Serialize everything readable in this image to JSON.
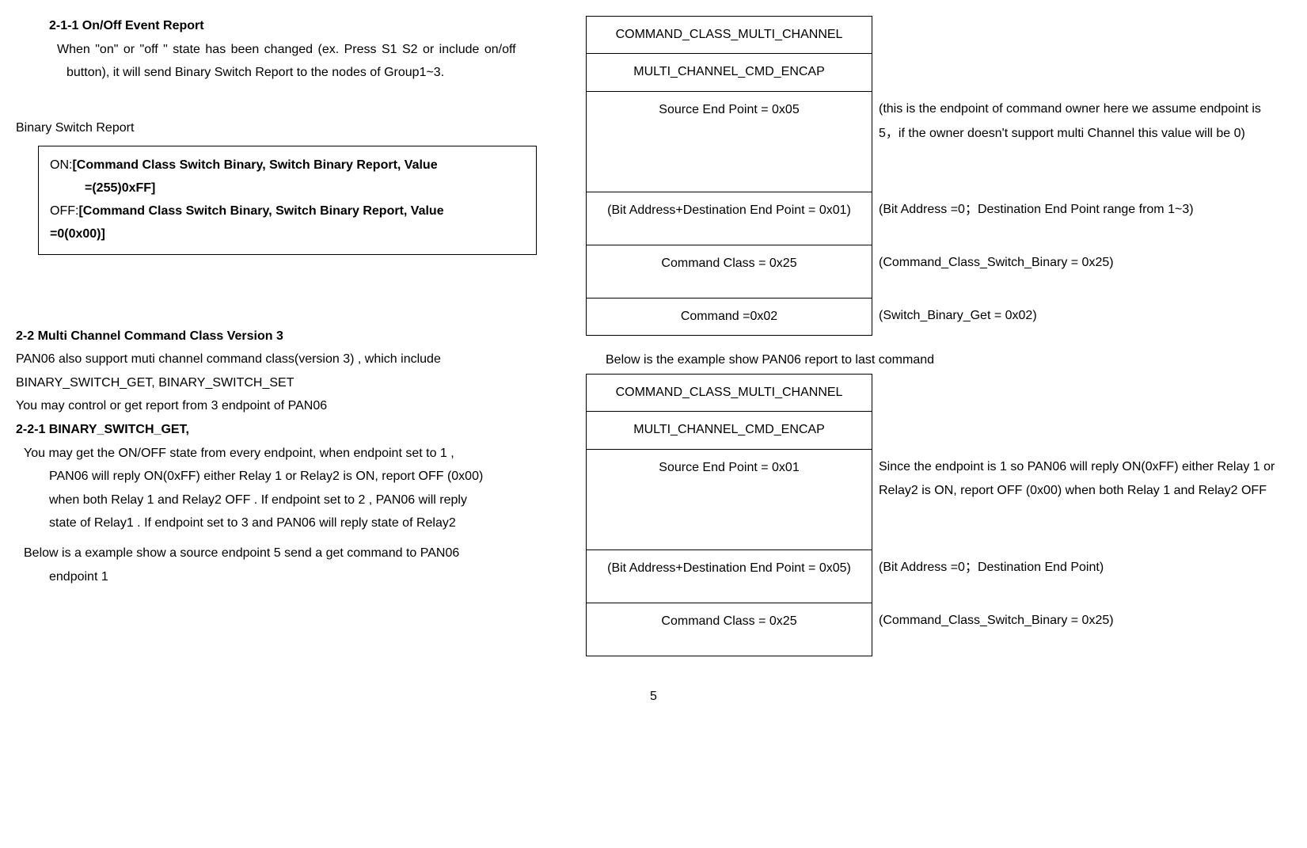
{
  "left": {
    "h211": "2-1-1 On/Off Event Report",
    "p211a": "When \"on\" or \"off \" state has been changed (ex. Press S1 S2 or include on/off",
    "p211b": "button), it will send Binary Switch Report to the nodes of Group1~3.",
    "bsr_title": "Binary Switch Report",
    "box_on_prefix": "ON:",
    "box_on_body1": "[Command Class Switch Binary, Switch Binary Report, Value",
    "box_on_body2": "=(255)0xFF]",
    "box_off_prefix": "OFF:",
    "box_off_body1": "[Command Class Switch Binary, Switch Binary Report, Value",
    "box_off_body2": "=0(0x00)]",
    "h22": "2-2 Multi Channel Command Class Version 3",
    "p22a": "PAN06 also support muti channel command class(version 3) , which include",
    "p22b": "BINARY_SWITCH_GET, BINARY_SWITCH_SET",
    "p22c": "You may control or get report from 3 endpoint of PAN06",
    "h221": "2-2-1 BINARY_SWITCH_GET,",
    "p221a": "You may get the ON/OFF state from every endpoint, when endpoint set to 1 ,",
    "p221b": "PAN06 will reply ON(0xFF) either Relay 1 or Relay2 is ON, report OFF (0x00)",
    "p221c": "when both Relay 1 and Relay2  OFF .  If endpoint set to 2 , PAN06 will reply",
    "p221d": "state of Relay1 . If endpoint set to 3 and PAN06 will reply state of Relay2",
    "p221e": "Below is a example show a source endpoint 5 send a get command to PAN06",
    "p221f": "endpoint 1"
  },
  "table1": {
    "r1l": "COMMAND_CLASS_MULTI_CHANNEL",
    "r2l": "MULTI_CHANNEL_CMD_ENCAP",
    "r3l": "Source End Point = 0x05",
    "r3r": "(this is the endpoint of command owner here we assume endpoint is 5，if the owner doesn't support multi Channel this value will be 0)",
    "r4l": "(Bit Address+Destination End Point = 0x01)",
    "r4r": "(Bit Address =0；Destination End Point range from 1~3)",
    "r5l": "Command Class = 0x25",
    "r5r": "(Command_Class_Switch_Binary = 0x25)",
    "r6l": "Command =0x02",
    "r6r": "(Switch_Binary_Get = 0x02)"
  },
  "table2_caption": "Below is the example show PAN06 report to last command",
  "table2": {
    "r1l": "COMMAND_CLASS_MULTI_CHANNEL",
    "r2l": "MULTI_CHANNEL_CMD_ENCAP",
    "r3l": "Source End Point = 0x01",
    "r3r": "Since  the endpoint is 1 so PAN06 will reply ON(0xFF) either Relay 1 or Relay2 is ON, report OFF (0x00) when both Relay 1 and Relay2  OFF",
    "r4l": "(Bit Address+Destination End Point = 0x05)",
    "r4r": "(Bit Address =0；Destination End Point)",
    "r5l": "Command Class = 0x25",
    "r5r": "(Command_Class_Switch_Binary = 0x25)"
  },
  "page_number": "5"
}
